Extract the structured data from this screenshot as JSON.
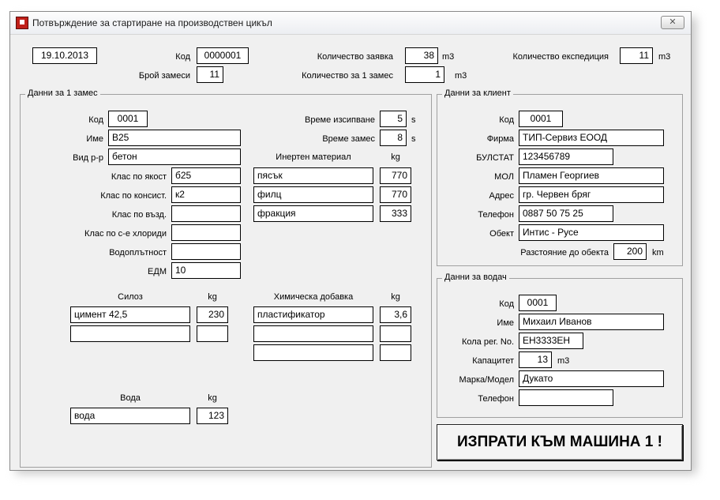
{
  "window": {
    "title": "Потвърждение за стартиране на производствен цикъл"
  },
  "header": {
    "date": "19.10.2013",
    "code_label": "Код",
    "code": "0000001",
    "mixes_label": "Брой замеси",
    "mixes": "11",
    "ordered_label": "Количество заявка",
    "ordered": "38",
    "ordered_unit": "m3",
    "per_mix_label": "Количество за 1 замес",
    "per_mix": "1",
    "per_mix_unit": "m3",
    "shipped_label": "Количество експедиция",
    "shipped": "11",
    "shipped_unit": "m3"
  },
  "mix": {
    "title": "Данни за 1 замес",
    "code_label": "Код",
    "code": "0001",
    "name_label": "Име",
    "name": "B25",
    "type_label": "Вид р-р",
    "type": "бетон",
    "strength_label": "Клас по якост",
    "strength": "б25",
    "consistency_label": "Клас по консист.",
    "consistency": "к2",
    "air_label": "Клас по възд.",
    "air": "",
    "chloride_label": "Клас по с-е хлориди",
    "chloride": "",
    "water_tight_label": "Водоплътност",
    "water_tight": "",
    "edm_label": "ЕДМ",
    "edm": "10",
    "pour_time_label": "Време изсипване",
    "pour_time": "5",
    "pour_unit": "s",
    "mix_time_label": "Време замес",
    "mix_time": "8",
    "mix_unit": "s",
    "inert_header": "Инертен материал",
    "inert_kg_header": "kg",
    "inert": [
      {
        "name": "пясък",
        "kg": "770"
      },
      {
        "name": "филц",
        "kg": "770"
      },
      {
        "name": "фракция",
        "kg": "333"
      }
    ],
    "silo_header": "Силоз",
    "silo_kg_header": "kg",
    "silo": [
      {
        "name": "цимент 42,5",
        "kg": "230"
      },
      {
        "name": "",
        "kg": ""
      }
    ],
    "chem_header": "Химическа добавка",
    "chem_kg_header": "kg",
    "chem": [
      {
        "name": "пластификатор",
        "kg": "3,6"
      },
      {
        "name": "",
        "kg": ""
      },
      {
        "name": "",
        "kg": ""
      }
    ],
    "water_header": "Вода",
    "water_kg_header": "kg",
    "water": {
      "name": "вода",
      "kg": "123"
    }
  },
  "client": {
    "title": "Данни за клиент",
    "code_label": "Код",
    "code": "0001",
    "company_label": "Фирма",
    "company": "ТИП-Сервиз ЕООД",
    "bulstat_label": "БУЛСТАТ",
    "bulstat": "123456789",
    "mol_label": "МОЛ",
    "mol": "Пламен Георгиев",
    "address_label": "Адрес",
    "address": "гр. Червен бряг",
    "phone_label": "Телефон",
    "phone": "0887 50 75 25",
    "site_label": "Обект",
    "site": "Интис - Русе",
    "distance_label": "Разстояние до обекта",
    "distance": "200",
    "distance_unit": "km"
  },
  "driver": {
    "title": "Данни за водач",
    "code_label": "Код",
    "code": "0001",
    "name_label": "Име",
    "name": "Михаил Иванов",
    "plate_label": "Кола рег. No.",
    "plate": "ЕН3333ЕН",
    "capacity_label": "Капацитет",
    "capacity": "13",
    "capacity_unit": "m3",
    "model_label": "Марка/Модел",
    "model": "Дукато",
    "phone_label": "Телефон",
    "phone": ""
  },
  "send_button": "ИЗПРАТИ КЪМ МАШИНА 1 !"
}
